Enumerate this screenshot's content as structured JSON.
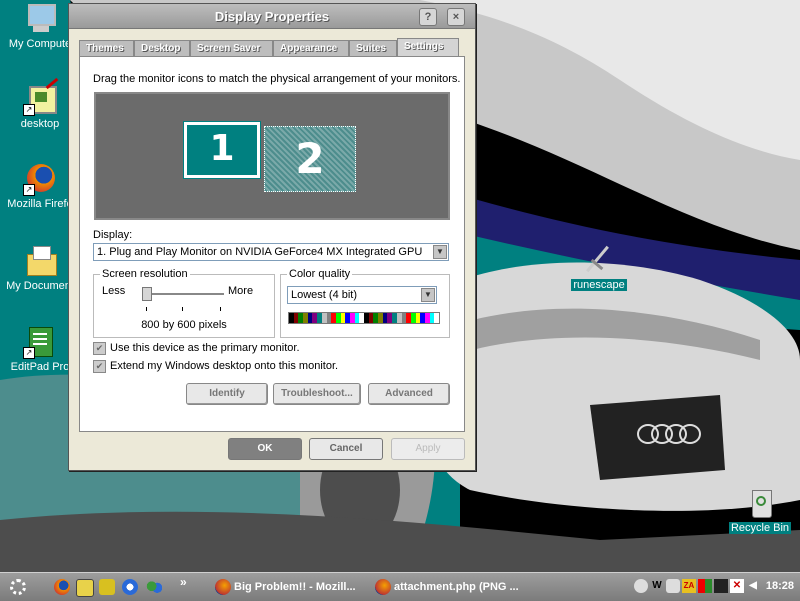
{
  "desktop": {
    "icons": [
      {
        "label": "My Compute",
        "icon": "my-computer-icon"
      },
      {
        "label": "desktop",
        "icon": "desktop-shortcut-icon"
      },
      {
        "label": "Mozilla Firefo",
        "icon": "firefox-icon"
      },
      {
        "label": "My Document",
        "icon": "my-documents-icon"
      },
      {
        "label": "EditPad Pro",
        "icon": "editpad-icon"
      },
      {
        "label": "runescape",
        "icon": "runescape-sword-icon"
      },
      {
        "label": "Recycle Bin",
        "icon": "recycle-bin-icon"
      }
    ]
  },
  "dialog": {
    "title": "Display Properties",
    "help_btn": "?",
    "close_btn": "×",
    "tabs": [
      "Themes",
      "Desktop",
      "Screen Saver",
      "Appearance",
      "Suites",
      "Settings"
    ],
    "active_tab": "Settings",
    "instructions": "Drag the monitor icons to match the physical arrangement of your monitors.",
    "monitor1": "1",
    "monitor2": "2",
    "display_label": "Display:",
    "display_value": "1. Plug and Play Monitor on NVIDIA GeForce4 MX Integrated GPU",
    "resolution": {
      "group_label": "Screen resolution",
      "less": "Less",
      "more": "More",
      "value": "800 by 600 pixels",
      "slider_position": 0
    },
    "color_quality": {
      "group_label": "Color quality",
      "value": "Lowest (4 bit)"
    },
    "primary_checkbox": "Use this device as the primary monitor.",
    "extend_checkbox": "Extend my Windows desktop onto this monitor.",
    "identify_btn": "Identify",
    "troubleshoot_btn": "Troubleshoot...",
    "advanced_btn": "Advanced",
    "ok_btn": "OK",
    "cancel_btn": "Cancel",
    "apply_btn": "Apply"
  },
  "taskbar": {
    "more_btn": "»",
    "tasks": [
      {
        "label": "Big Problem!! - Mozill..."
      },
      {
        "label": "attachment.php (PNG ..."
      }
    ],
    "tray_w": "W",
    "tray_za": "ZA",
    "clock": "18:28"
  },
  "colors": {
    "teal": "#008080",
    "dialog_bg": "#ece9d8",
    "ok_button": "#808080"
  }
}
